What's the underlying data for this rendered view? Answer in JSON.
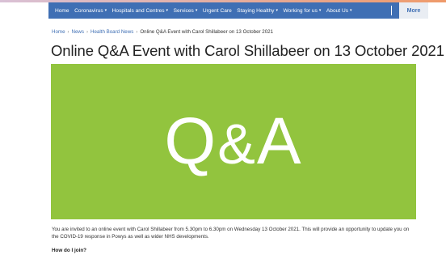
{
  "colors": {
    "accent": "#3f6fb4",
    "hero_bg": "#92c43e",
    "hero_fg": "#ffffff",
    "top_gradient_start": "#d9c1d6",
    "top_gradient_end": "#ef9a6a"
  },
  "nav": {
    "items": [
      {
        "label": "Home",
        "has_dropdown": false
      },
      {
        "label": "Coronavirus",
        "has_dropdown": true
      },
      {
        "label": "Hospitals and Centres",
        "has_dropdown": true
      },
      {
        "label": "Services",
        "has_dropdown": true
      },
      {
        "label": "Urgent Care",
        "has_dropdown": false
      },
      {
        "label": "Staying Healthy",
        "has_dropdown": true
      },
      {
        "label": "Working for us",
        "has_dropdown": true
      },
      {
        "label": "About Us",
        "has_dropdown": true
      }
    ],
    "caret_icon": "chevron-down-icon",
    "more_label": "More"
  },
  "breadcrumb": {
    "items": [
      "Home",
      "News",
      "Health Board News"
    ],
    "current": "Online Q&A Event with Carol Shillabeer on 13 October 2021",
    "separator": "›"
  },
  "article": {
    "title": "Online Q&A Event with Carol Shillabeer on 13 October 2021",
    "hero_text_q": "Q",
    "hero_text_amp": "&",
    "hero_text_a": "A",
    "intro": "You are invited to an online event with Carol Shillabeer from 5.30pm to 6.30pm on Wednesday 13 October 2021. This will provide an opportunity to update you on the COVID-19 response in Powys as well as wider NHS developments.",
    "howto_heading": "How do I join?"
  }
}
